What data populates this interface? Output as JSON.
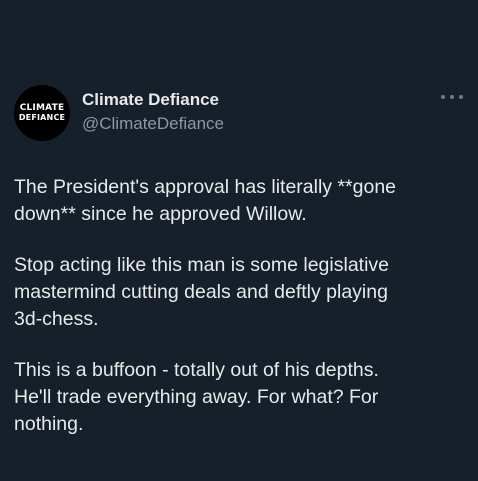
{
  "author": {
    "name": "Climate Defiance",
    "handle": "@ClimateDefiance",
    "avatar_logo": {
      "line1": "CLIMATE",
      "line2": "DEFIANCE"
    }
  },
  "menu": {
    "icon": "more-horizontal-icon"
  },
  "tweet": {
    "paragraphs": [
      "The President's approval has literally **gone\ndown** since he approved Willow.",
      "Stop acting like this man is some legislative\nmastermind cutting deals and deftly playing\n3d-chess.",
      "This is a buffoon - totally out of his depths.\nHe'll trade everything away. For what? For\nnothing."
    ]
  },
  "colors": {
    "background": "#15202b",
    "primary_text": "#e7e9ea",
    "secondary_text": "#8b98a5"
  }
}
